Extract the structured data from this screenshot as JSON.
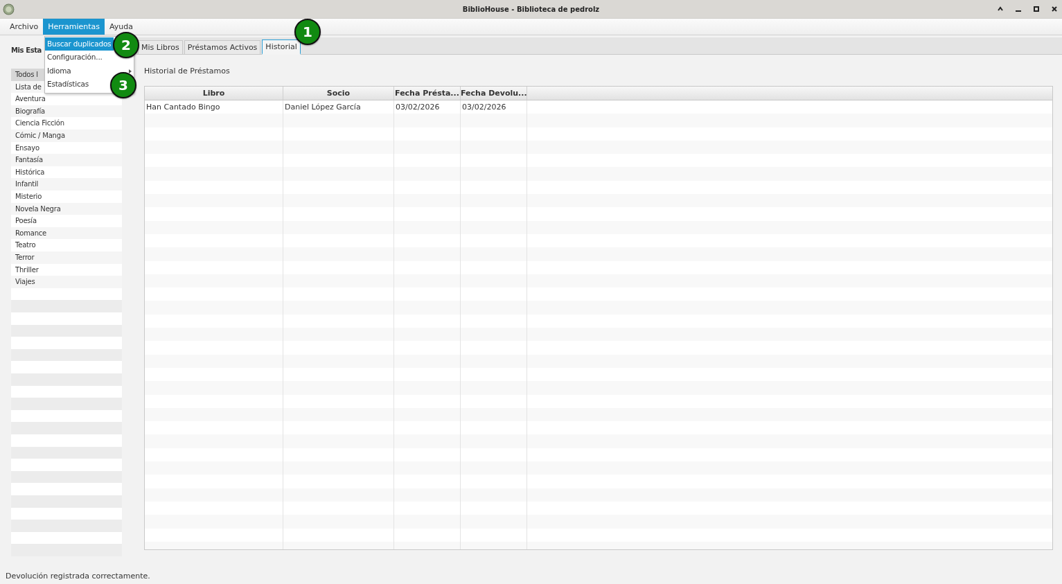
{
  "window": {
    "title": "BiblioHouse - Biblioteca de pedrolz"
  },
  "menubar": [
    {
      "label": "Archivo",
      "selected": false
    },
    {
      "label": "Herramientas",
      "selected": true
    },
    {
      "label": "Ayuda",
      "selected": false
    }
  ],
  "open_menu": {
    "items": [
      {
        "label": "Buscar duplicados",
        "selected": true,
        "submenu": false
      },
      {
        "label": "Configuración...",
        "selected": false,
        "submenu": false
      },
      {
        "label": "Idioma",
        "selected": false,
        "submenu": true
      },
      {
        "label": "Estadísticas",
        "selected": false,
        "submenu": false
      }
    ]
  },
  "sidebar": {
    "title": "Mis Esta",
    "items": [
      {
        "label": "Todos l",
        "selected": true
      },
      {
        "label": "Lista de",
        "selected": false
      },
      {
        "label": "Aventura",
        "selected": false
      },
      {
        "label": "Biografía",
        "selected": false
      },
      {
        "label": "Ciencia Ficción",
        "selected": false
      },
      {
        "label": "Cómic / Manga",
        "selected": false
      },
      {
        "label": "Ensayo",
        "selected": false
      },
      {
        "label": "Fantasía",
        "selected": false
      },
      {
        "label": "Histórica",
        "selected": false
      },
      {
        "label": "Infantil",
        "selected": false
      },
      {
        "label": "Misterio",
        "selected": false
      },
      {
        "label": "Novela Negra",
        "selected": false
      },
      {
        "label": "Poesía",
        "selected": false
      },
      {
        "label": "Romance",
        "selected": false
      },
      {
        "label": "Teatro",
        "selected": false
      },
      {
        "label": "Terror",
        "selected": false
      },
      {
        "label": "Thriller",
        "selected": false
      },
      {
        "label": "Viajes",
        "selected": false
      }
    ]
  },
  "tabs": [
    {
      "label": "Mis Libros",
      "selected": false
    },
    {
      "label": "Préstamos Activos",
      "selected": false
    },
    {
      "label": "Historial",
      "selected": true
    }
  ],
  "section_title": "Historial de Préstamos",
  "table": {
    "columns": [
      "Libro",
      "Socio",
      "Fecha Présta...",
      "Fecha Devolu..."
    ],
    "rows": [
      [
        "Han Cantado Bingo",
        "Daniel López García",
        "03/02/2026",
        "03/02/2026"
      ]
    ]
  },
  "status_bar": "Devolución registrada correctamente.",
  "callouts": [
    "1",
    "2",
    "3"
  ]
}
